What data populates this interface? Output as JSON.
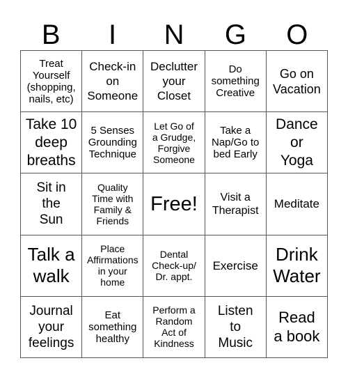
{
  "header": {
    "letters": [
      "B",
      "I",
      "N",
      "G",
      "O"
    ]
  },
  "cells": [
    [
      "Treat\nYourself\n(shopping,\nnails, etc)",
      "Check-in\non\nSomeone",
      "Declutter\nyour\nCloset",
      "Do\nsomething\nCreative",
      "Go on\nVacation"
    ],
    [
      "Take 10\ndeep\nbreaths",
      "5 Senses\nGrounding\nTechnique",
      "Let Go of\na Grudge,\nForgive\nSomeone",
      "Take a\nNap/Go to\nbed Early",
      "Dance\nor\nYoga"
    ],
    [
      "Sit in\nthe\nSun",
      "Quality\nTime with\nFamily &\nFriends",
      "Free!",
      "Visit a\nTherapist",
      "Meditate"
    ],
    [
      "Talk a\nwalk",
      "Place\nAffirmations\nin your\nhome",
      "Dental\nCheck-up/\nDr. appt.",
      "Exercise",
      "Drink\nWater"
    ],
    [
      "Journal\nyour\nfeelings",
      "Eat\nsomething\nhealthy",
      "Perform a\nRandom\nAct of\nKindness",
      "Listen\nto\nMusic",
      "Read\na book"
    ]
  ]
}
